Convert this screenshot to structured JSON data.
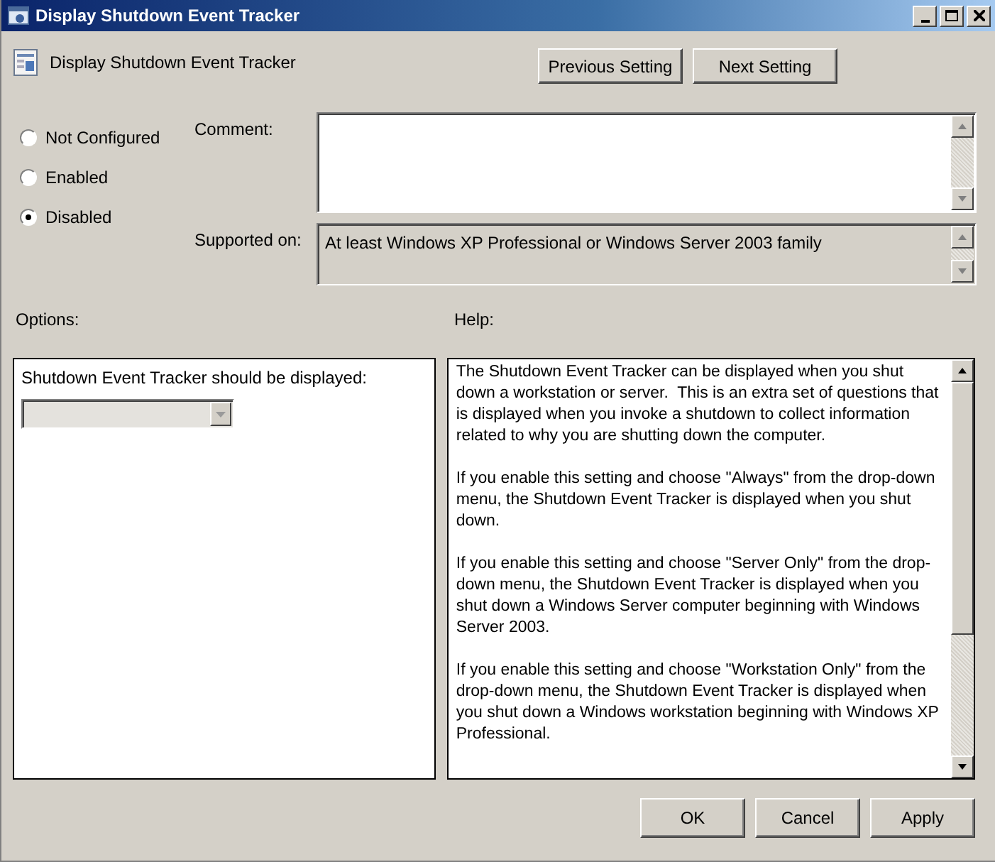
{
  "window": {
    "title": "Display Shutdown Event Tracker"
  },
  "header": {
    "setting_name": "Display Shutdown Event Tracker",
    "buttons": [
      "Previous Setting",
      "Next Setting"
    ]
  },
  "state_options": [
    {
      "label": "Not Configured",
      "selected": false
    },
    {
      "label": "Enabled",
      "selected": false
    },
    {
      "label": "Disabled",
      "selected": true
    }
  ],
  "comment": {
    "label": "Comment:"
  },
  "supported_on": {
    "label": "Supported on:",
    "value": "At least Windows XP Professional or Windows Server 2003 family"
  },
  "options": {
    "label": "Options:",
    "prompt": "Shutdown Event Tracker should be displayed:",
    "dropdown": {
      "disabled": true
    }
  },
  "help": {
    "label": "Help:",
    "paragraphs": [
      "The Shutdown Event Tracker can be displayed when you shut down a workstation or server.  This is an extra set of questions that is displayed when you invoke a shutdown to collect information related to why you are shutting down the computer.",
      "If you enable this setting and choose \"Always\" from the drop-down menu, the Shutdown Event Tracker is displayed when you shut down.",
      "If you enable this setting and choose \"Server Only\" from the drop-down menu, the Shutdown Event Tracker is displayed when you shut down a Windows Server computer beginning with Windows Server 2003.",
      "If you enable this setting and choose \"Workstation Only\" from the drop-down menu, the Shutdown Event Tracker is displayed when you shut down a Windows workstation beginning with Windows XP Professional."
    ]
  },
  "buttons": [
    "OK",
    "Cancel",
    "Apply"
  ]
}
